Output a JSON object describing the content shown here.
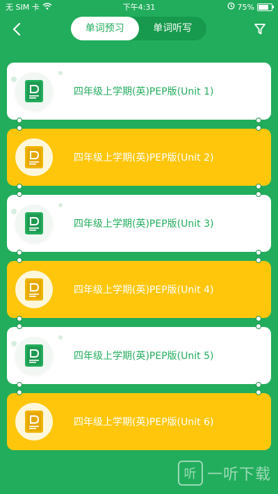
{
  "status_bar": {
    "carrier": "无 SIM 卡",
    "time": "下午4:31",
    "battery": "75%"
  },
  "nav": {
    "tabs": [
      {
        "label": "单词预习",
        "active": true
      },
      {
        "label": "单词听写",
        "active": false
      }
    ]
  },
  "units": [
    {
      "title": "四年级上学期(英)PEP版(Unit 1)",
      "style": "white"
    },
    {
      "title": "四年级上学期(英)PEP版(Unit 2)",
      "style": "yellow"
    },
    {
      "title": "四年级上学期(英)PEP版(Unit 3)",
      "style": "white"
    },
    {
      "title": "四年级上学期(英)PEP版(Unit 4)",
      "style": "yellow"
    },
    {
      "title": "四年级上学期(英)PEP版(Unit 5)",
      "style": "white"
    },
    {
      "title": "四年级上学期(英)PEP版(Unit 6)",
      "style": "yellow"
    }
  ],
  "watermark": {
    "text": "一听下载",
    "logo_char": "听"
  },
  "colors": {
    "brand_green": "#22ad5c",
    "card_yellow": "#ffc60b",
    "card_white": "#ffffff"
  },
  "icons": [
    "back-icon",
    "filter-icon",
    "wifi-icon",
    "alarm-icon",
    "battery-icon",
    "book-icon"
  ]
}
